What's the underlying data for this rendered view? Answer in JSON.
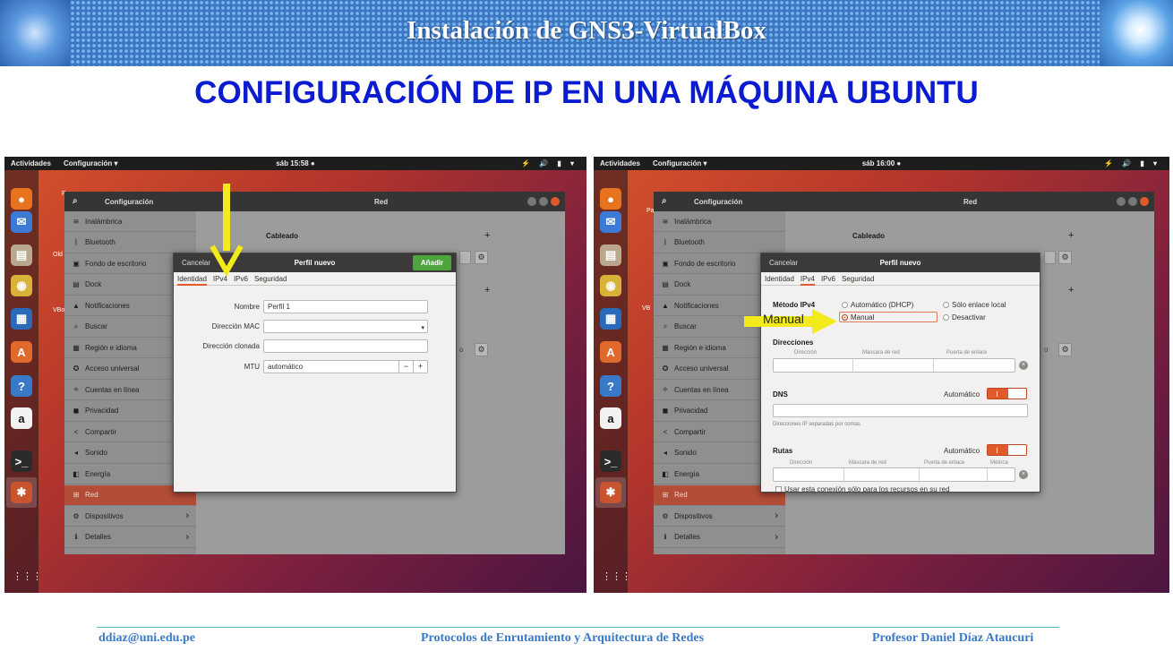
{
  "header": {
    "title": "Instalación de GNS3-VirtualBox"
  },
  "heading": "CONFIGURACIÓN DE IP EN UNA MÁQUINA UBUNTU",
  "colors": {
    "accent": "#e05a2b",
    "add_button": "#4ea43c",
    "heading": "#0b1bd1",
    "arrow": "#f2ea1a"
  },
  "ubuntu": {
    "activities": "Actividades",
    "app_menu": "Configuración ▾",
    "tray": "⚡ 🔊 ▮ ▾",
    "window_title": "Configuración",
    "panel_title": "Red",
    "sidebar": [
      {
        "icon": "wifi-icon",
        "glyph": "≋",
        "label": "Inalámbrica"
      },
      {
        "icon": "bluetooth-icon",
        "glyph": "ᛒ",
        "label": "Bluetooth"
      },
      {
        "icon": "background-icon",
        "glyph": "▣",
        "label": "Fondo de escritorio"
      },
      {
        "icon": "dock-icon",
        "glyph": "▤",
        "label": "Dock"
      },
      {
        "icon": "bell-icon",
        "glyph": "▲",
        "label": "Notificaciones"
      },
      {
        "icon": "search-icon",
        "glyph": "⌕",
        "label": "Buscar"
      },
      {
        "icon": "region-icon",
        "glyph": "▦",
        "label": "Región e idioma"
      },
      {
        "icon": "accessibility-icon",
        "glyph": "✪",
        "label": "Acceso universal"
      },
      {
        "icon": "online-accounts-icon",
        "glyph": "⟡",
        "label": "Cuentas en línea"
      },
      {
        "icon": "privacy-icon",
        "glyph": "◼",
        "label": "Privacidad"
      },
      {
        "icon": "share-icon",
        "glyph": "<",
        "label": "Compartir"
      },
      {
        "icon": "sound-icon",
        "glyph": "◂",
        "label": "Sonido"
      },
      {
        "icon": "power-icon",
        "glyph": "◧",
        "label": "Energía"
      },
      {
        "icon": "network-icon",
        "glyph": "⊞",
        "label": "Red"
      },
      {
        "icon": "devices-icon",
        "glyph": "⚙",
        "label": "Dispositivos"
      },
      {
        "icon": "details-icon",
        "glyph": "ℹ",
        "label": "Detalles"
      }
    ],
    "wired_label": "Cableado",
    "plus": "+",
    "dialog": {
      "cancel": "Cancelar",
      "title": "Perfil nuevo",
      "add": "Añadir",
      "tabs": [
        "Identidad",
        "IPv4",
        "IPv6",
        "Seguridad"
      ]
    },
    "dock_labels": [
      "Pa",
      "Old",
      "VBo",
      "Pa",
      "VB"
    ]
  },
  "shot1": {
    "clock": "sáb 15:58 ●",
    "proxy_text": "o",
    "form": [
      {
        "label": "Nombre",
        "value": "Perfil 1"
      },
      {
        "label": "Dirección MAC",
        "value": ""
      },
      {
        "label": "Dirección clonada",
        "value": ""
      },
      {
        "label": "MTU",
        "value": "automático"
      }
    ],
    "stepper": {
      "minus": "−",
      "plus": "+"
    },
    "dropdown_glyph": "▾"
  },
  "shot2": {
    "clock": "sáb 16:00 ●",
    "proxy_text": "o",
    "ipv4_method_label": "Método IPv4",
    "methods": [
      {
        "label": "Automático (DHCP)",
        "selected": false
      },
      {
        "label": "Sólo enlace local",
        "selected": false
      },
      {
        "label": "Manual",
        "selected": true
      },
      {
        "label": "Desactivar",
        "selected": false
      }
    ],
    "addresses_label": "Direcciones",
    "addr_cols": [
      "Dirección",
      "Máscara de red",
      "Puerta de enlace"
    ],
    "dns_label": "DNS",
    "auto_label": "Automático",
    "dns_toggle": true,
    "dns_hint": "Direcciones IP separadas por comas",
    "routes_label": "Rutas",
    "routes_toggle": true,
    "route_cols": [
      "Dirección",
      "Máscara de red",
      "Puerta de enlace",
      "Métrica"
    ],
    "only_resources": "Usar esta conexión sólo para los recursos en su red",
    "annotation": "Manual"
  },
  "footer": {
    "email": "ddiaz@uni.edu.pe",
    "course": "Protocolos de Enrutamiento y Arquitectura de Redes",
    "professor": "Profesor Daniel Díaz Ataucuri"
  }
}
